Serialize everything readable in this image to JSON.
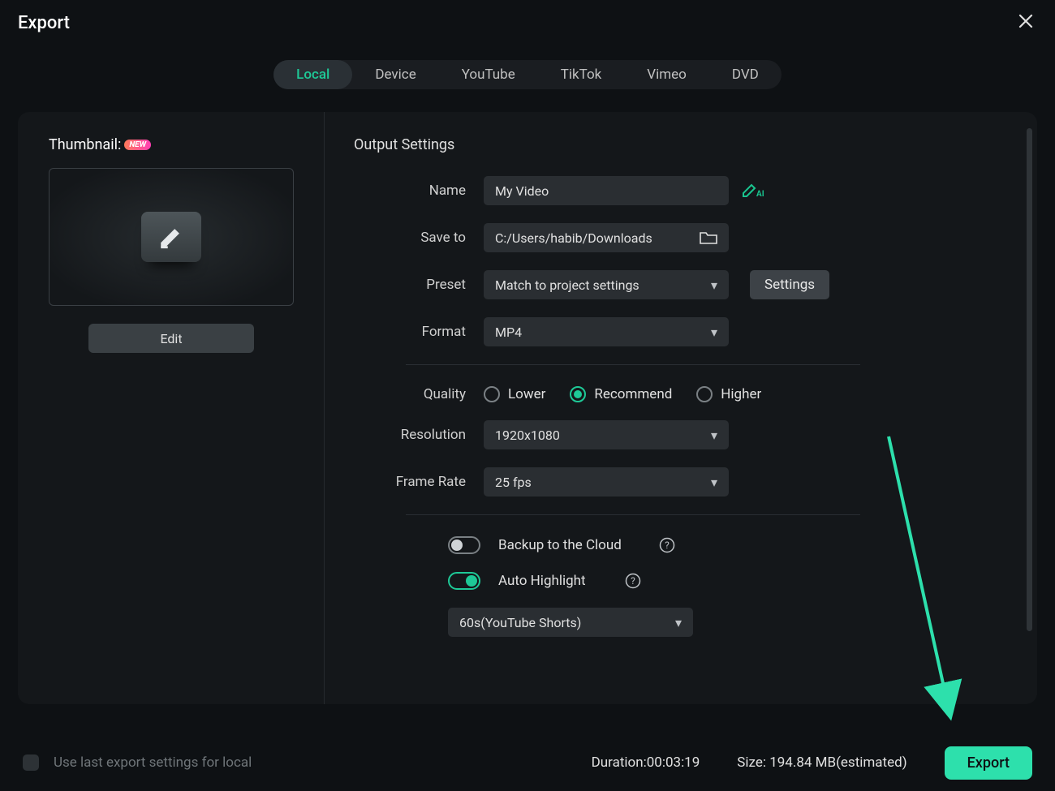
{
  "title": "Export",
  "tabs": [
    "Local",
    "Device",
    "YouTube",
    "TikTok",
    "Vimeo",
    "DVD"
  ],
  "active_tab": "Local",
  "thumbnail": {
    "label": "Thumbnail:",
    "badge": "NEW",
    "edit": "Edit"
  },
  "output": {
    "heading": "Output Settings",
    "name_label": "Name",
    "name_value": "My Video",
    "saveto_label": "Save to",
    "saveto_value": "C:/Users/habib/Downloads",
    "preset_label": "Preset",
    "preset_value": "Match to project settings",
    "settings_btn": "Settings",
    "format_label": "Format",
    "format_value": "MP4",
    "quality_label": "Quality",
    "quality_options": {
      "lower": "Lower",
      "recommend": "Recommend",
      "higher": "Higher"
    },
    "resolution_label": "Resolution",
    "resolution_value": "1920x1080",
    "framerate_label": "Frame Rate",
    "framerate_value": "25 fps",
    "backup_label": "Backup to the Cloud",
    "highlight_label": "Auto Highlight",
    "highlight_preset": "60s(YouTube Shorts)"
  },
  "footer": {
    "checkbox_label": "Use last export settings for local",
    "duration_label": "Duration:",
    "duration_value": "00:03:19",
    "size_label": "Size: ",
    "size_value": "194.84 MB(estimated)",
    "export_btn": "Export"
  },
  "colors": {
    "accent": "#1ec997",
    "export_btn": "#2de0ac"
  }
}
